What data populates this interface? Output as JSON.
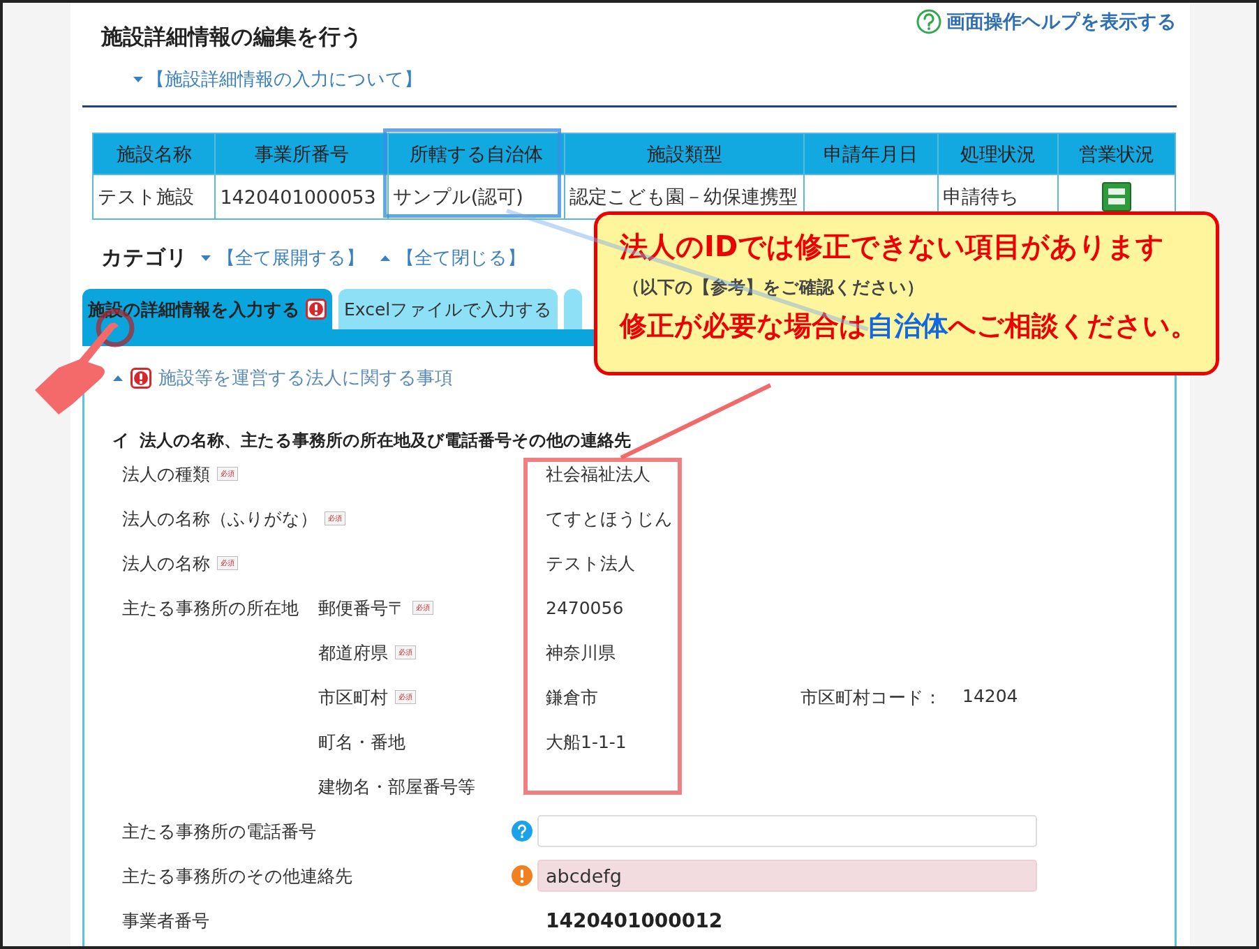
{
  "header": {
    "title": "施設詳細情報の編集を行う",
    "help_link": "画面操作ヘルプを表示する",
    "info_link": "【施設詳細情報の入力について】"
  },
  "facility_table": {
    "columns": [
      "施設名称",
      "事業所番号",
      "所轄する自治体",
      "施設類型",
      "申請年月日",
      "処理状況",
      "営業状況"
    ],
    "rows": [
      {
        "cells": [
          "テスト施設",
          "1420401000053",
          "サンプル(認可)",
          "認定こども園－幼保連携型",
          "",
          "申請待ち"
        ]
      }
    ]
  },
  "category": {
    "label": "カテゴリ",
    "expand_all": "【全て展開する】",
    "collapse_all": "【全て閉じる】"
  },
  "tabs": [
    {
      "label": "施設の詳細情報を入力する",
      "selected": true,
      "alert": true
    },
    {
      "label": "Excelファイルで入力する",
      "selected": false,
      "alert": false
    },
    {
      "selected": false,
      "alert": false
    }
  ],
  "section": {
    "title": "施設等を運営する法人に関する事項",
    "expanded": true,
    "alert": true
  },
  "subsection": {
    "marker": "イ",
    "title": "法人の名称、主たる事務所の所在地及び電話番号その他の連絡先"
  },
  "fields": [
    {
      "kind": "display",
      "label": "法人の種類",
      "badge": "必須",
      "value": "社会福祉法人"
    },
    {
      "kind": "display",
      "label": "法人の名称（ふりがな）",
      "badge": "必須",
      "value": "てすとほうじん"
    },
    {
      "kind": "display",
      "label": "法人の名称",
      "badge": "必須",
      "value": "テスト法人"
    },
    {
      "kind": "display",
      "label": "主たる事務所の所在地",
      "sublabel": "郵便番号〒",
      "badge": "必須",
      "value": "2470056"
    },
    {
      "kind": "display",
      "sublabel": "都道府県",
      "badge": "必須",
      "value": "神奈川県"
    },
    {
      "kind": "display",
      "sublabel": "市区町村",
      "badge": "必須",
      "value": "鎌倉市",
      "extra_label": "市区町村コード：",
      "extra_value": "14204"
    },
    {
      "kind": "display",
      "sublabel": "町名・番地",
      "value": "大船1-1-1"
    },
    {
      "kind": "display",
      "sublabel": "建物名・部屋番号等"
    },
    {
      "kind": "input",
      "label": "主たる事務所の電話番号",
      "error": false
    },
    {
      "kind": "input",
      "label": "主たる事務所のその他連絡先",
      "error": true,
      "value": "abcdefg"
    },
    {
      "kind": "strong",
      "label": "事業者番号",
      "value": "1420401000012"
    }
  ],
  "callout": {
    "heading": "法人のIDでは修正できない項目があります",
    "note": "（以下の【参考】をご確認ください）",
    "segments": [
      {
        "text": "修正が必要な場合は",
        "emphasis": false
      },
      {
        "text": "自治体",
        "emphasis": true
      },
      {
        "text": "へご相談ください。",
        "emphasis": false
      }
    ]
  }
}
